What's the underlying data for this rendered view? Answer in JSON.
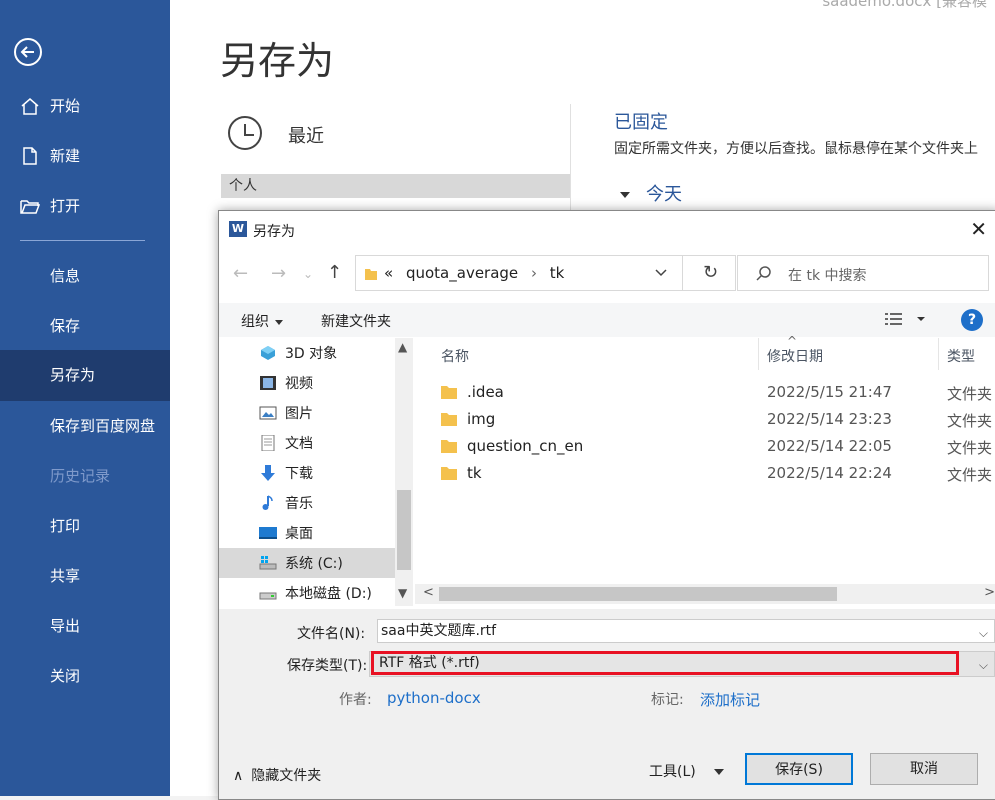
{
  "sidebar": {
    "items": [
      {
        "label": "开始",
        "icon": "home-icon"
      },
      {
        "label": "新建",
        "icon": "new-document-icon"
      },
      {
        "label": "打开",
        "icon": "open-folder-icon"
      },
      {
        "label": "信息"
      },
      {
        "label": "保存"
      },
      {
        "label": "另存为",
        "active": true
      },
      {
        "label": "保存到百度网盘"
      },
      {
        "label": "历史记录",
        "disabled": true
      },
      {
        "label": "打印"
      },
      {
        "label": "共享"
      },
      {
        "label": "导出"
      },
      {
        "label": "关闭"
      }
    ]
  },
  "main": {
    "doc_title": "saademo.docx [兼容模",
    "page_title": "另存为",
    "recent_label": "最近",
    "personal_label": "个人",
    "pinned_title": "已固定",
    "pinned_desc": "固定所需文件夹，方便以后查找。鼠标悬停在某个文件夹上",
    "today_label": "今天"
  },
  "dialog": {
    "title": "另存为",
    "address": {
      "prefix": "«",
      "crumbs": [
        "quota_average",
        "tk"
      ]
    },
    "search_placeholder": "在 tk 中搜索",
    "toolbar": {
      "organize": "组织",
      "new_folder": "新建文件夹"
    },
    "tree": [
      {
        "label": "3D 对象",
        "icon": "3d-objects-icon"
      },
      {
        "label": "视频",
        "icon": "video-icon"
      },
      {
        "label": "图片",
        "icon": "pictures-icon"
      },
      {
        "label": "文档",
        "icon": "documents-icon"
      },
      {
        "label": "下载",
        "icon": "download-icon"
      },
      {
        "label": "音乐",
        "icon": "music-icon"
      },
      {
        "label": "桌面",
        "icon": "desktop-icon"
      },
      {
        "label": "系统 (C:)",
        "icon": "system-drive-icon",
        "selected": true
      },
      {
        "label": "本地磁盘 (D:)",
        "icon": "local-disk-icon"
      }
    ],
    "columns": {
      "name": "名称",
      "modified": "修改日期",
      "type": "类型"
    },
    "files": [
      {
        "name": ".idea",
        "modified": "2022/5/15 21:47",
        "type": "文件夹"
      },
      {
        "name": "img",
        "modified": "2022/5/14 23:23",
        "type": "文件夹"
      },
      {
        "name": "question_cn_en",
        "modified": "2022/5/14 22:05",
        "type": "文件夹"
      },
      {
        "name": "tk",
        "modified": "2022/5/14 22:24",
        "type": "文件夹"
      }
    ],
    "form": {
      "filename_label": "文件名(N):",
      "filename_value": "saa中英文题库.rtf",
      "filetype_label": "保存类型(T):",
      "filetype_value": "RTF 格式 (*.rtf)",
      "author_label": "作者:",
      "author_value": "python-docx",
      "tags_label": "标记:",
      "tags_value": "添加标记",
      "hide_folders": "隐藏文件夹",
      "tools": "工具(L)",
      "save": "保存(S)",
      "cancel": "取消"
    }
  },
  "colors": {
    "sidebar": "#2b579a",
    "sidebar_active": "#1f3c6e",
    "link": "#1e6fc9",
    "highlight": "#e81123"
  }
}
